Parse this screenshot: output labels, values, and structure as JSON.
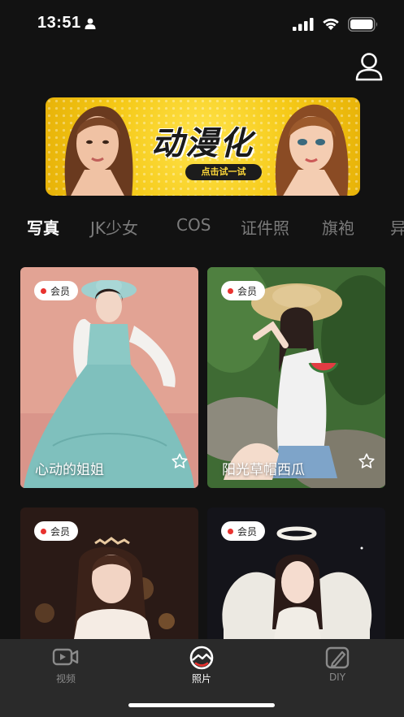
{
  "status_bar": {
    "time": "13:51",
    "icons": [
      "person-icon",
      "signal-icon",
      "wifi-icon",
      "battery-icon"
    ]
  },
  "header": {
    "profile_icon": "user-icon"
  },
  "banner": {
    "title": "动漫化",
    "cta_label": "点击试一试",
    "colors": {
      "background": "#f5c917",
      "cta_bg": "#1c1c1c",
      "cta_text": "#ffd93a"
    }
  },
  "tabs": [
    {
      "label": "写真",
      "active": true
    },
    {
      "label": "JK少女",
      "active": false
    },
    {
      "label": "COS",
      "active": false
    },
    {
      "label": "证件照",
      "active": false
    },
    {
      "label": "旗袍",
      "active": false
    },
    {
      "label": "异",
      "active": false
    }
  ],
  "cards": [
    {
      "badge": "会员",
      "title": "心动的姐姐",
      "fav_icon": "star-outline-icon"
    },
    {
      "badge": "会员",
      "title": "阳光草帽西瓜",
      "fav_icon": "star-outline-icon"
    },
    {
      "badge": "会员",
      "title": ""
    },
    {
      "badge": "会员",
      "title": ""
    }
  ],
  "bottom_nav": [
    {
      "label": "视频",
      "icon": "video-icon",
      "active": false
    },
    {
      "label": "照片",
      "icon": "photo-icon",
      "active": true
    },
    {
      "label": "DIY",
      "icon": "brush-icon",
      "active": false
    }
  ],
  "colors": {
    "page_bg": "#121212",
    "nav_bg": "#2a2a2a",
    "badge_dot": "#e8322f",
    "tab_inactive": "#7b7b7b"
  }
}
